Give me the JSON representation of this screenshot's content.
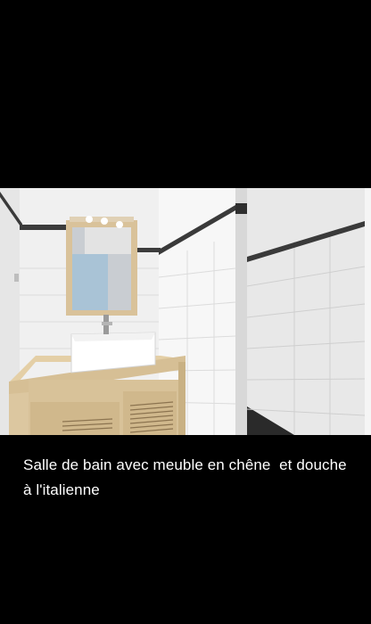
{
  "photo": {
    "icon": "bathroom-photo",
    "colors": {
      "background": "#000000",
      "tile": "#f1f1f1",
      "wood": "#dcc7a1",
      "frieze": "#3a3a3a",
      "caption": "#ffffff"
    }
  },
  "caption": {
    "text": "Salle de bain avec meuble en chêne  et douche à l'italienne"
  }
}
